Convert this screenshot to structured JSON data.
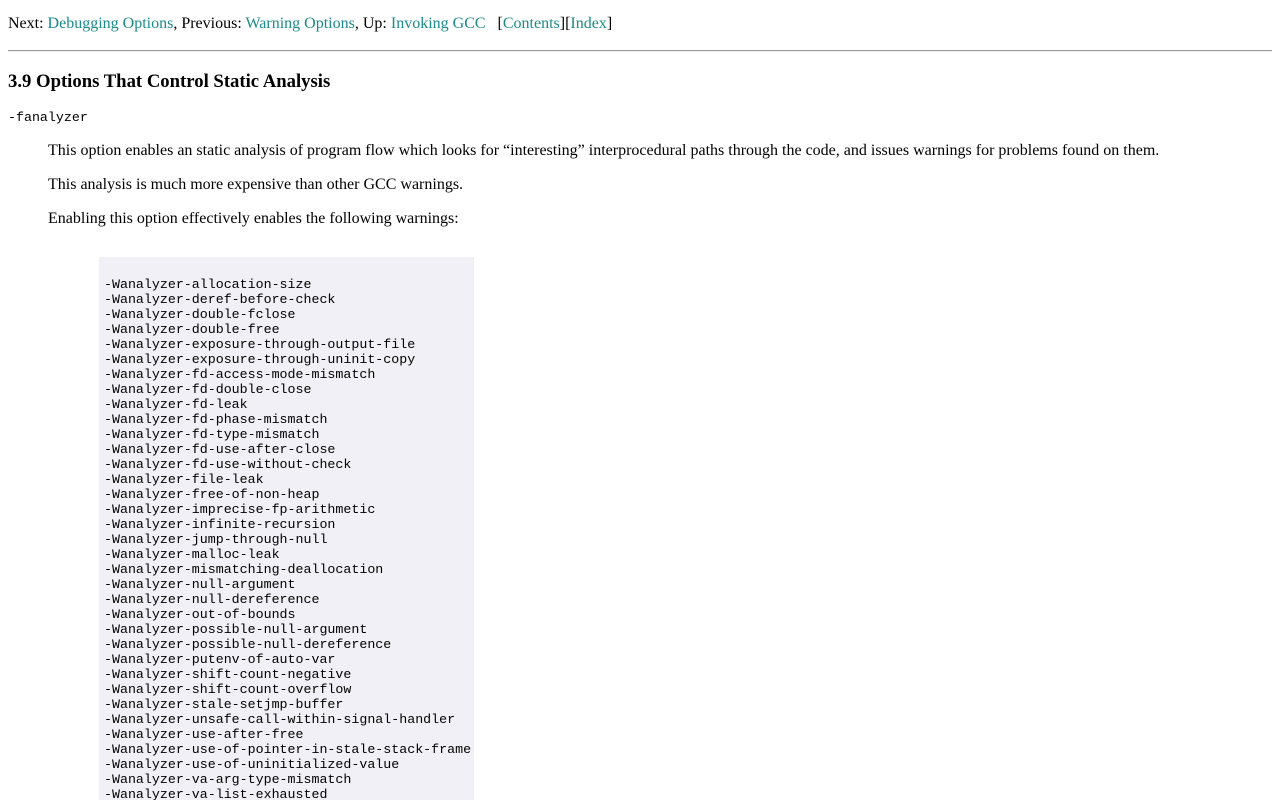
{
  "nav": {
    "next_prefix": "Next: ",
    "next_link": "Debugging Options",
    "previous_prefix": ", Previous: ",
    "previous_link": "Warning Options",
    "up_prefix": ", Up: ",
    "up_link": "Invoking GCC",
    "bracket_open": "[",
    "contents_link": "Contents",
    "bracket_mid": "][",
    "index_link": "Index",
    "bracket_close": "]"
  },
  "section": {
    "title": "3.9 Options That Control Static Analysis"
  },
  "option": {
    "term": "-fanalyzer",
    "paragraphs": [
      "This option enables an static analysis of program flow which looks for “interesting” interprocedural paths through the code, and issues warnings for problems found on them.",
      "This analysis is much more expensive than other GCC warnings.",
      "Enabling this option effectively enables the following warnings:"
    ]
  },
  "warnings": [
    "-Wanalyzer-allocation-size",
    "-Wanalyzer-deref-before-check",
    "-Wanalyzer-double-fclose",
    "-Wanalyzer-double-free",
    "-Wanalyzer-exposure-through-output-file",
    "-Wanalyzer-exposure-through-uninit-copy",
    "-Wanalyzer-fd-access-mode-mismatch",
    "-Wanalyzer-fd-double-close",
    "-Wanalyzer-fd-leak",
    "-Wanalyzer-fd-phase-mismatch",
    "-Wanalyzer-fd-type-mismatch",
    "-Wanalyzer-fd-use-after-close",
    "-Wanalyzer-fd-use-without-check",
    "-Wanalyzer-file-leak",
    "-Wanalyzer-free-of-non-heap",
    "-Wanalyzer-imprecise-fp-arithmetic",
    "-Wanalyzer-infinite-recursion",
    "-Wanalyzer-jump-through-null",
    "-Wanalyzer-malloc-leak",
    "-Wanalyzer-mismatching-deallocation",
    "-Wanalyzer-null-argument",
    "-Wanalyzer-null-dereference",
    "-Wanalyzer-out-of-bounds",
    "-Wanalyzer-possible-null-argument",
    "-Wanalyzer-possible-null-dereference",
    "-Wanalyzer-putenv-of-auto-var",
    "-Wanalyzer-shift-count-negative",
    "-Wanalyzer-shift-count-overflow",
    "-Wanalyzer-stale-setjmp-buffer",
    "-Wanalyzer-unsafe-call-within-signal-handler",
    "-Wanalyzer-use-after-free",
    "-Wanalyzer-use-of-pointer-in-stale-stack-frame",
    "-Wanalyzer-use-of-uninitialized-value",
    "-Wanalyzer-va-arg-type-mismatch",
    "-Wanalyzer-va-list-exhausted"
  ],
  "colors": {
    "link": "#1a8a8a",
    "example_background": "#f0f0f6",
    "rule": "#9a9a9a"
  }
}
